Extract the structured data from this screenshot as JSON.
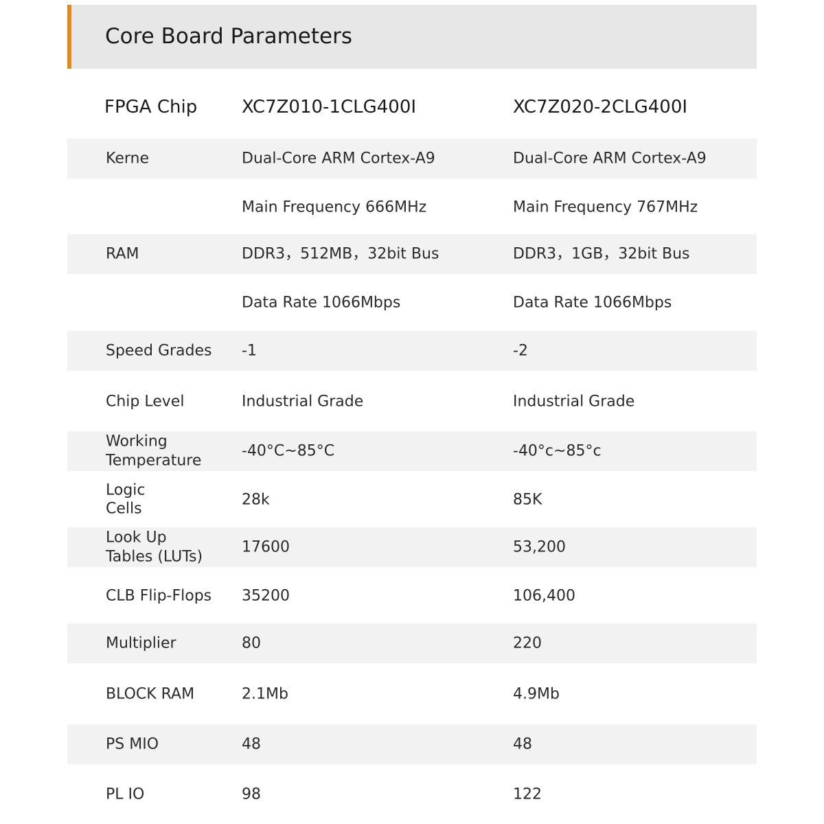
{
  "header": {
    "title": "Core Board Parameters",
    "accent_color": "#e08a1e",
    "background_color": "#e7e7e7"
  },
  "table": {
    "columns": {
      "label": "FPGA Chip",
      "model_1": "XC7Z010-1CLG400I",
      "model_2": "XC7Z020-2CLG400I"
    },
    "rows": [
      {
        "label": "Kerne",
        "v1": "Dual-Core ARM Cortex-A9",
        "v2": "Dual-Core ARM Cortex-A9",
        "shaded": true
      },
      {
        "label": "",
        "v1": "Main Frequency 666MHz",
        "v2": "Main Frequency 767MHz",
        "shaded": false
      },
      {
        "label": "RAM",
        "v1": "DDR3，512MB，32bit Bus",
        "v2": "DDR3，1GB，32bit Bus",
        "shaded": true
      },
      {
        "label": "",
        "v1": "Data Rate 1066Mbps",
        "v2": "Data Rate 1066Mbps",
        "shaded": false
      },
      {
        "label": "Speed Grades",
        "v1": "-1",
        "v2": "-2",
        "shaded": true
      },
      {
        "label": "Chip Level",
        "v1": "Industrial Grade",
        "v2": "Industrial Grade",
        "shaded": false
      },
      {
        "label": "Working\nTemperature",
        "v1": "-40°C~85°C",
        "v2": "-40°c~85°c",
        "shaded": true
      },
      {
        "label": "Logic\nCells",
        "v1": "28k",
        "v2": "85K",
        "shaded": false
      },
      {
        "label": "Look Up\nTables (LUTs)",
        "v1": "17600",
        "v2": "53,200",
        "shaded": true
      },
      {
        "label": "CLB Flip-Flops",
        "v1": "35200",
        "v2": "106,400",
        "shaded": false
      },
      {
        "label": "Multiplier",
        "v1": "80",
        "v2": "220",
        "shaded": true
      },
      {
        "label": "BLOCK RAM",
        "v1": "2.1Mb",
        "v2": "4.9Mb",
        "shaded": false
      },
      {
        "label": "PS MIO",
        "v1": "48",
        "v2": "48",
        "shaded": true
      },
      {
        "label": "PL IO",
        "v1": "98",
        "v2": "122",
        "shaded": false
      }
    ]
  }
}
